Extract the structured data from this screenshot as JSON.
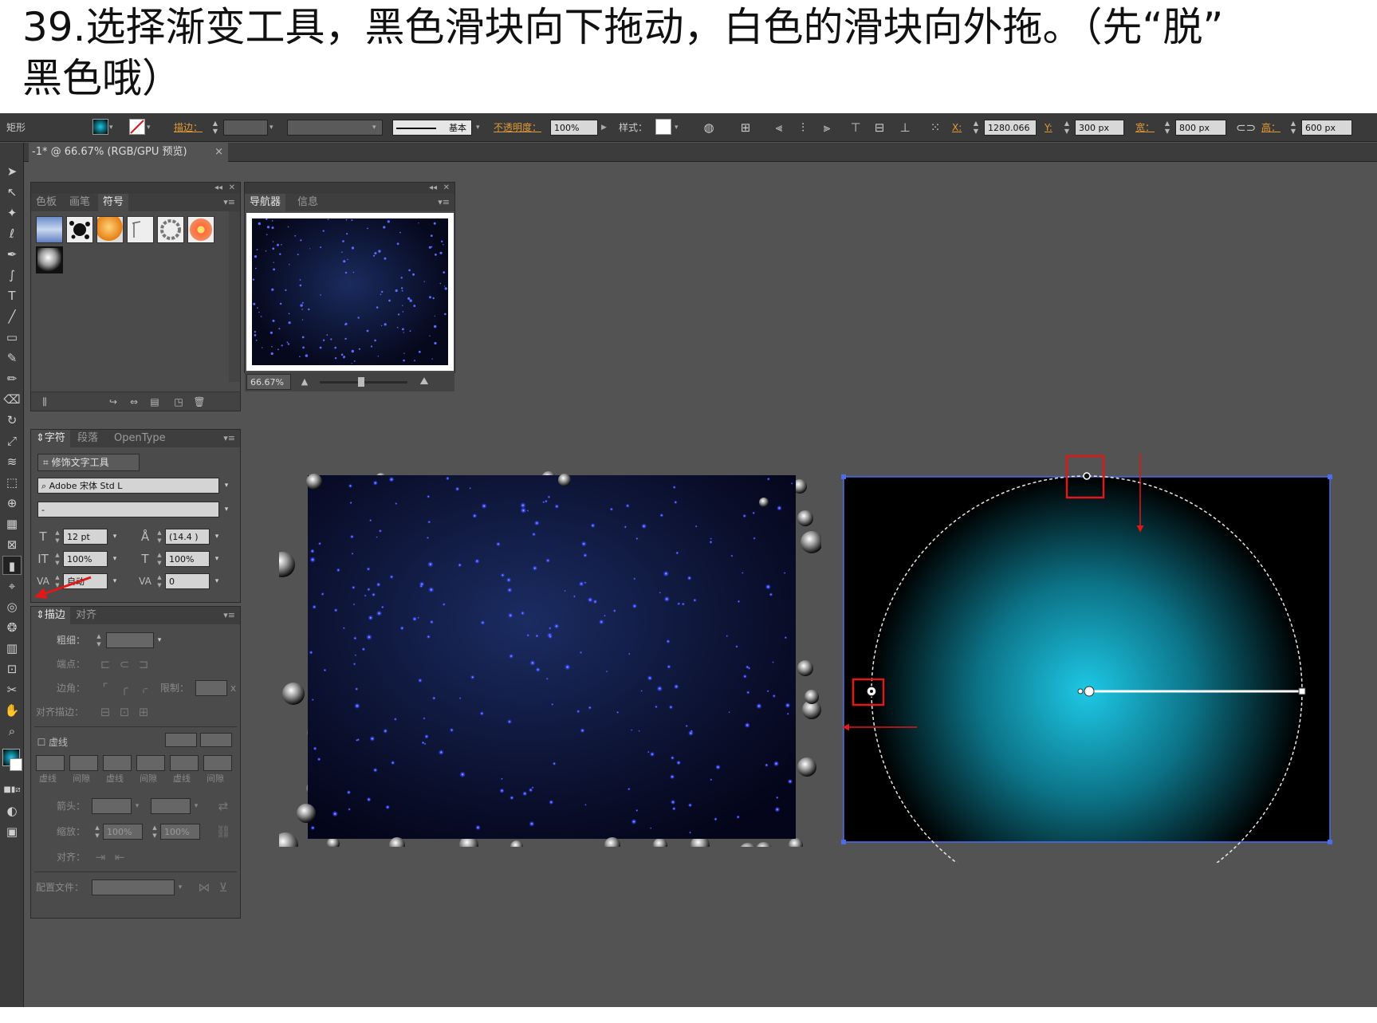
{
  "caption": {
    "line1": "39.选择渐变工具，黑色滑块向下拖动，白色的滑块向外拖。（先“脱”",
    "line2": "黑色哦）"
  },
  "control_bar": {
    "tool_name": "矩形",
    "stroke_label": "描边：",
    "stroke_style": "基本",
    "opacity_label": "不透明度：",
    "opacity_value": "100%",
    "style_label": "样式：",
    "x_label": "X:",
    "x_value": "1280.066",
    "y_label": "Y:",
    "y_value": "300 px",
    "w_label": "宽：",
    "w_value": "800 px",
    "h_label": "高：",
    "h_value": "600 px"
  },
  "document_tab": {
    "title": "-1* @ 66.67% (RGB/GPU 预览)",
    "close": "×"
  },
  "symbols_panel": {
    "tabs": [
      "色板",
      "画笔",
      "符号"
    ],
    "active_tab": "符号"
  },
  "navigator_panel": {
    "tabs": [
      "导航器",
      "信息"
    ],
    "active_tab": "导航器",
    "zoom": "66.67%"
  },
  "character_panel": {
    "tabs": [
      "字符",
      "段落",
      "OpenType"
    ],
    "touch_type_button": "修饰文字工具",
    "font_family": "Adobe 宋体 Std L",
    "font_style": "-",
    "font_size": "12 pt",
    "leading": "(14.4 )",
    "vertical_scale": "100%",
    "horizontal_scale": "100%",
    "kerning": "自动",
    "tracking": "0"
  },
  "stroke_panel": {
    "tabs": [
      "描边",
      "对齐"
    ],
    "weight_label": "粗细：",
    "cap_label": "端点：",
    "corner_label": "边角：",
    "limit_label": "限制：",
    "limit_suffix": "x",
    "align_label": "对齐描边：",
    "dashed_label": "虚线",
    "dash_labels": [
      "虚线",
      "间隙",
      "虚线",
      "间隙",
      "虚线",
      "间隙"
    ],
    "arrow_label": "箭头：",
    "scale_label": "缩放：",
    "scale_start": "100%",
    "scale_end": "100%",
    "align_arrow_label": "对齐：",
    "profile_label": "配置文件："
  },
  "colors": {
    "annotation_red": "#e01818",
    "gradient_center": "#1ec8e6",
    "gradient_edge": "#000000",
    "selection_blue": "#4a6cf0",
    "ui_bg": "#535353"
  }
}
